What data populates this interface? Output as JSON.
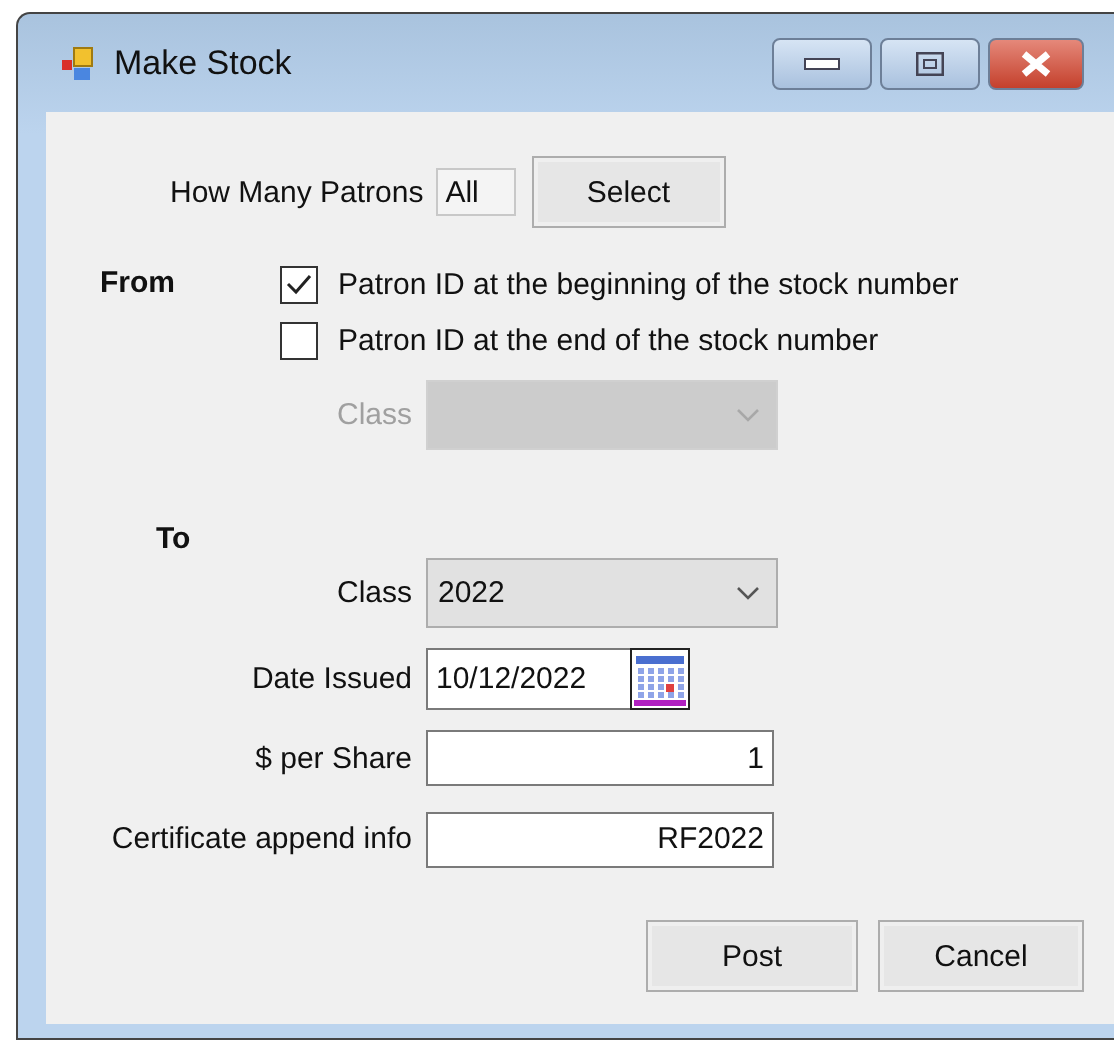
{
  "window": {
    "title": "Make Stock"
  },
  "patrons": {
    "label": "How Many Patrons",
    "value": "All",
    "button": "Select"
  },
  "from": {
    "heading": "From",
    "options": [
      {
        "label": "Patron ID at the beginning of the stock number",
        "checked": true
      },
      {
        "label": "Patron ID at the end of the stock number",
        "checked": false
      }
    ],
    "class": {
      "label": "Class",
      "disabled": true
    }
  },
  "to": {
    "heading": "To",
    "fields": [
      {
        "kind": "combo",
        "label": "Class",
        "value": "2022"
      },
      {
        "kind": "date",
        "label": "Date Issued",
        "value": "10/12/2022"
      },
      {
        "kind": "text",
        "label": "$ per Share",
        "value": "1"
      },
      {
        "kind": "text",
        "label": "Certificate append info",
        "value": "RF2022"
      }
    ]
  },
  "buttons": [
    "Post",
    "Cancel"
  ]
}
